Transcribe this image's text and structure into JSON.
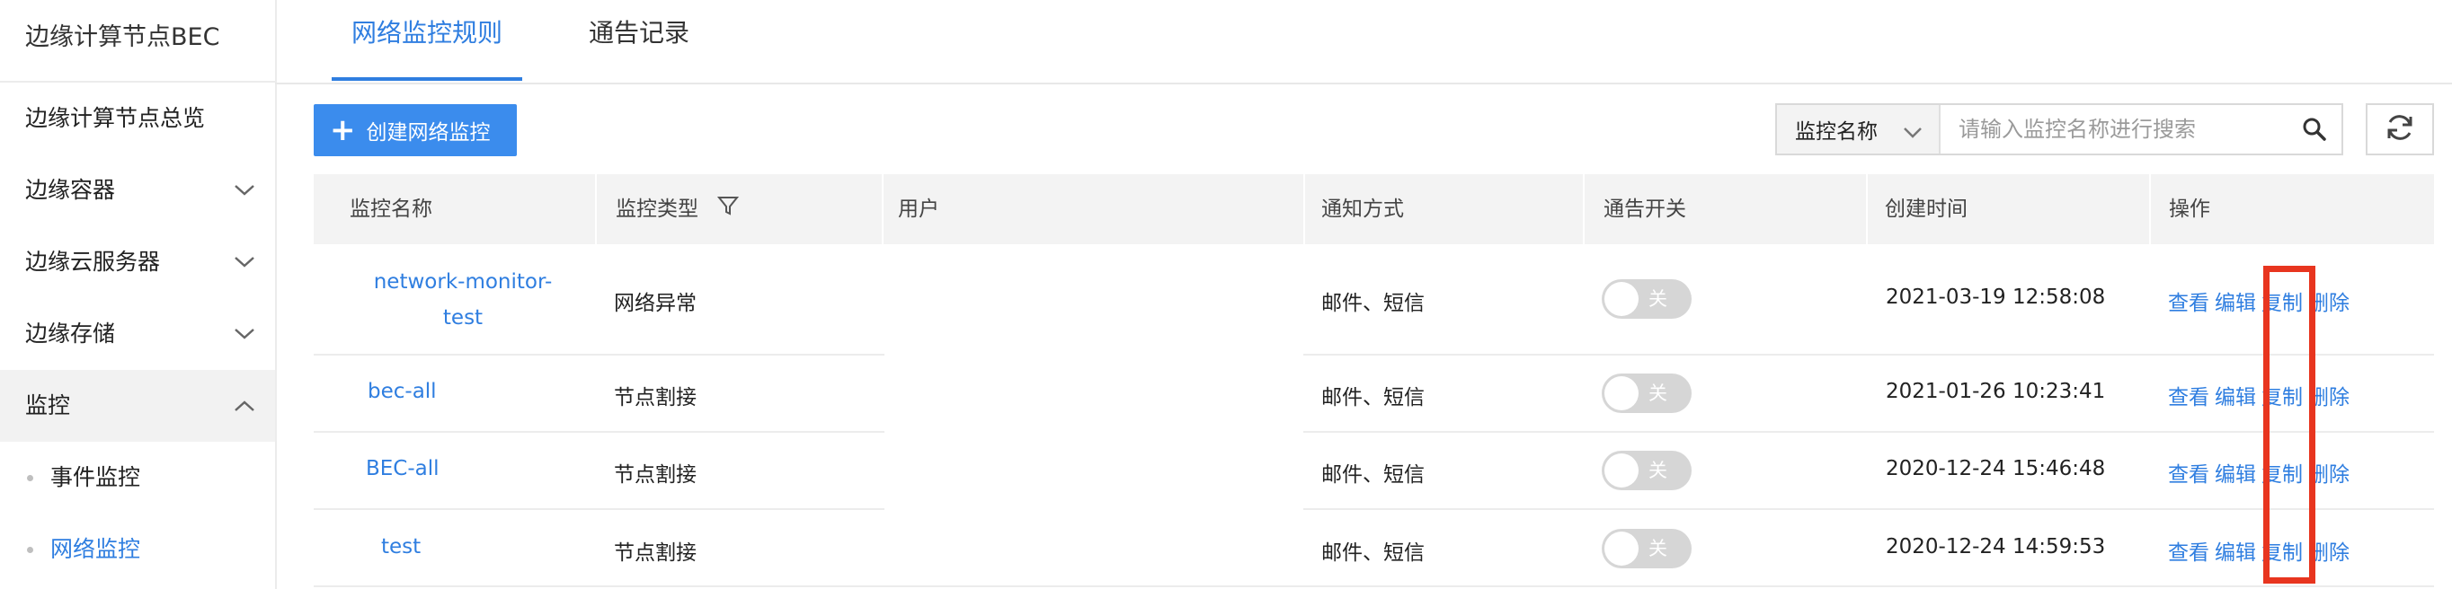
{
  "sidebar": {
    "title": "边缘计算节点BEC",
    "items": [
      {
        "label": "边缘计算节点总览",
        "has_chevron": false
      },
      {
        "label": "边缘容器",
        "has_chevron": true
      },
      {
        "label": "边缘云服务器",
        "has_chevron": true
      },
      {
        "label": "边缘存储",
        "has_chevron": true
      },
      {
        "label": "监控",
        "has_chevron": true,
        "expanded": true
      }
    ],
    "subitems": [
      {
        "label": "事件监控",
        "selected": false
      },
      {
        "label": "网络监控",
        "selected": true
      }
    ]
  },
  "tabs": [
    {
      "label": "网络监控规则",
      "active": true
    },
    {
      "label": "通告记录",
      "active": false
    }
  ],
  "toolbar": {
    "create_label": "创建网络监控",
    "search_field": "监控名称",
    "search_placeholder": "请输入监控名称进行搜索"
  },
  "table": {
    "columns": [
      "监控名称",
      "监控类型",
      "用户",
      "通知方式",
      "通告开关",
      "创建时间",
      "操作"
    ],
    "rows": [
      {
        "name_line1": "network-monitor-",
        "name_line2": "test",
        "type": "网络异常",
        "notify": "邮件、短信",
        "switch": "关",
        "created": "2021-03-19 12:58:08"
      },
      {
        "name_line1": "bec-all",
        "name_line2": "",
        "type": "节点割接",
        "notify": "邮件、短信",
        "switch": "关",
        "created": "2021-01-26 10:23:41"
      },
      {
        "name_line1": "BEC-all",
        "name_line2": "",
        "type": "节点割接",
        "notify": "邮件、短信",
        "switch": "关",
        "created": "2020-12-24 15:46:48"
      },
      {
        "name_line1": "test",
        "name_line2": "",
        "type": "节点割接",
        "notify": "邮件、短信",
        "switch": "关",
        "created": "2020-12-24 14:59:53"
      }
    ],
    "actions": {
      "view": "查看",
      "edit": "编辑",
      "copy": "复制",
      "delete": "删除"
    }
  },
  "colors": {
    "accent": "#2f7ee0",
    "button": "#3b8ced",
    "highlight": "#e8351f"
  }
}
